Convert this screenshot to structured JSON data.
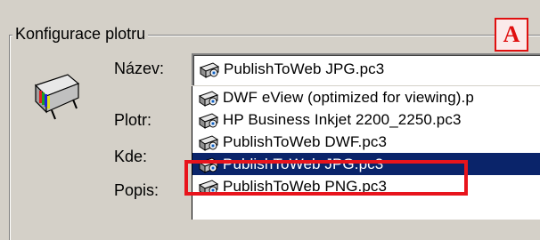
{
  "group": {
    "title": "Konfigurace plotru"
  },
  "annotation": {
    "letter": "A"
  },
  "labels": {
    "name": "Název:",
    "plotter": "Plotr:",
    "where": "Kde:",
    "description": "Popis:"
  },
  "name_combo": {
    "value": "PublishToWeb JPG.pc3"
  },
  "dropdown": {
    "items": [
      {
        "label": "DWF eView (optimized for viewing).p"
      },
      {
        "label": "HP Business Inkjet 2200_2250.pc3"
      },
      {
        "label": "PublishToWeb DWF.pc3"
      },
      {
        "label": "PublishToWeb JPG.pc3"
      },
      {
        "label": "PublishToWeb PNG.pc3"
      }
    ],
    "selected_index": 3
  },
  "colors": {
    "selection": "#0a246a",
    "highlight": "#e8141c"
  }
}
